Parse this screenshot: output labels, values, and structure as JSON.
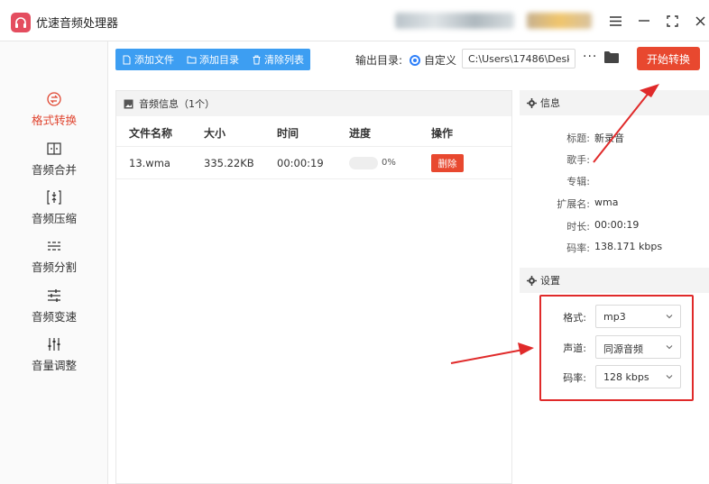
{
  "app": {
    "title": "优速音频处理器",
    "logo_icon": "headphones-icon"
  },
  "sidebar": {
    "items": [
      {
        "label": "格式转换",
        "icon": "convert-icon",
        "active": true
      },
      {
        "label": "音频合并",
        "icon": "merge-icon"
      },
      {
        "label": "音频压缩",
        "icon": "compress-icon"
      },
      {
        "label": "音频分割",
        "icon": "split-icon"
      },
      {
        "label": "音频变速",
        "icon": "speed-icon"
      },
      {
        "label": "音量调整",
        "icon": "volume-icon"
      }
    ]
  },
  "toolbar": {
    "add_file": "添加文件",
    "add_folder": "添加目录",
    "clear_list": "清除列表",
    "output_label": "输出目录:",
    "custom_label": "自定义",
    "output_path": "C:\\Users\\17486\\Deskto",
    "more": "···",
    "start": "开始转换"
  },
  "file_panel": {
    "header": "音频信息（1个）",
    "columns": [
      "文件名称",
      "大小",
      "时间",
      "进度",
      "操作"
    ],
    "rows": [
      {
        "name": "13.wma",
        "size": "335.22KB",
        "time": "00:00:19",
        "progress": "0%",
        "progress_value": 0,
        "action": "删除"
      }
    ]
  },
  "info": {
    "header": "信息",
    "fields": [
      {
        "key": "标题:",
        "value": "新录音"
      },
      {
        "key": "歌手:",
        "value": ""
      },
      {
        "key": "专辑:",
        "value": ""
      },
      {
        "key": "扩展名:",
        "value": "wma"
      },
      {
        "key": "时长:",
        "value": "00:00:19"
      },
      {
        "key": "码率:",
        "value": "138.171 kbps"
      }
    ]
  },
  "settings": {
    "header": "设置",
    "format_label": "格式:",
    "format_value": "mp3",
    "channel_label": "声道:",
    "channel_value": "同源音频",
    "bitrate_label": "码率:",
    "bitrate_value": "128 kbps"
  },
  "colors": {
    "accent": "#e8482f",
    "toolbar_blue": "#3d9ef2",
    "annotation_red": "#e02a2a"
  }
}
